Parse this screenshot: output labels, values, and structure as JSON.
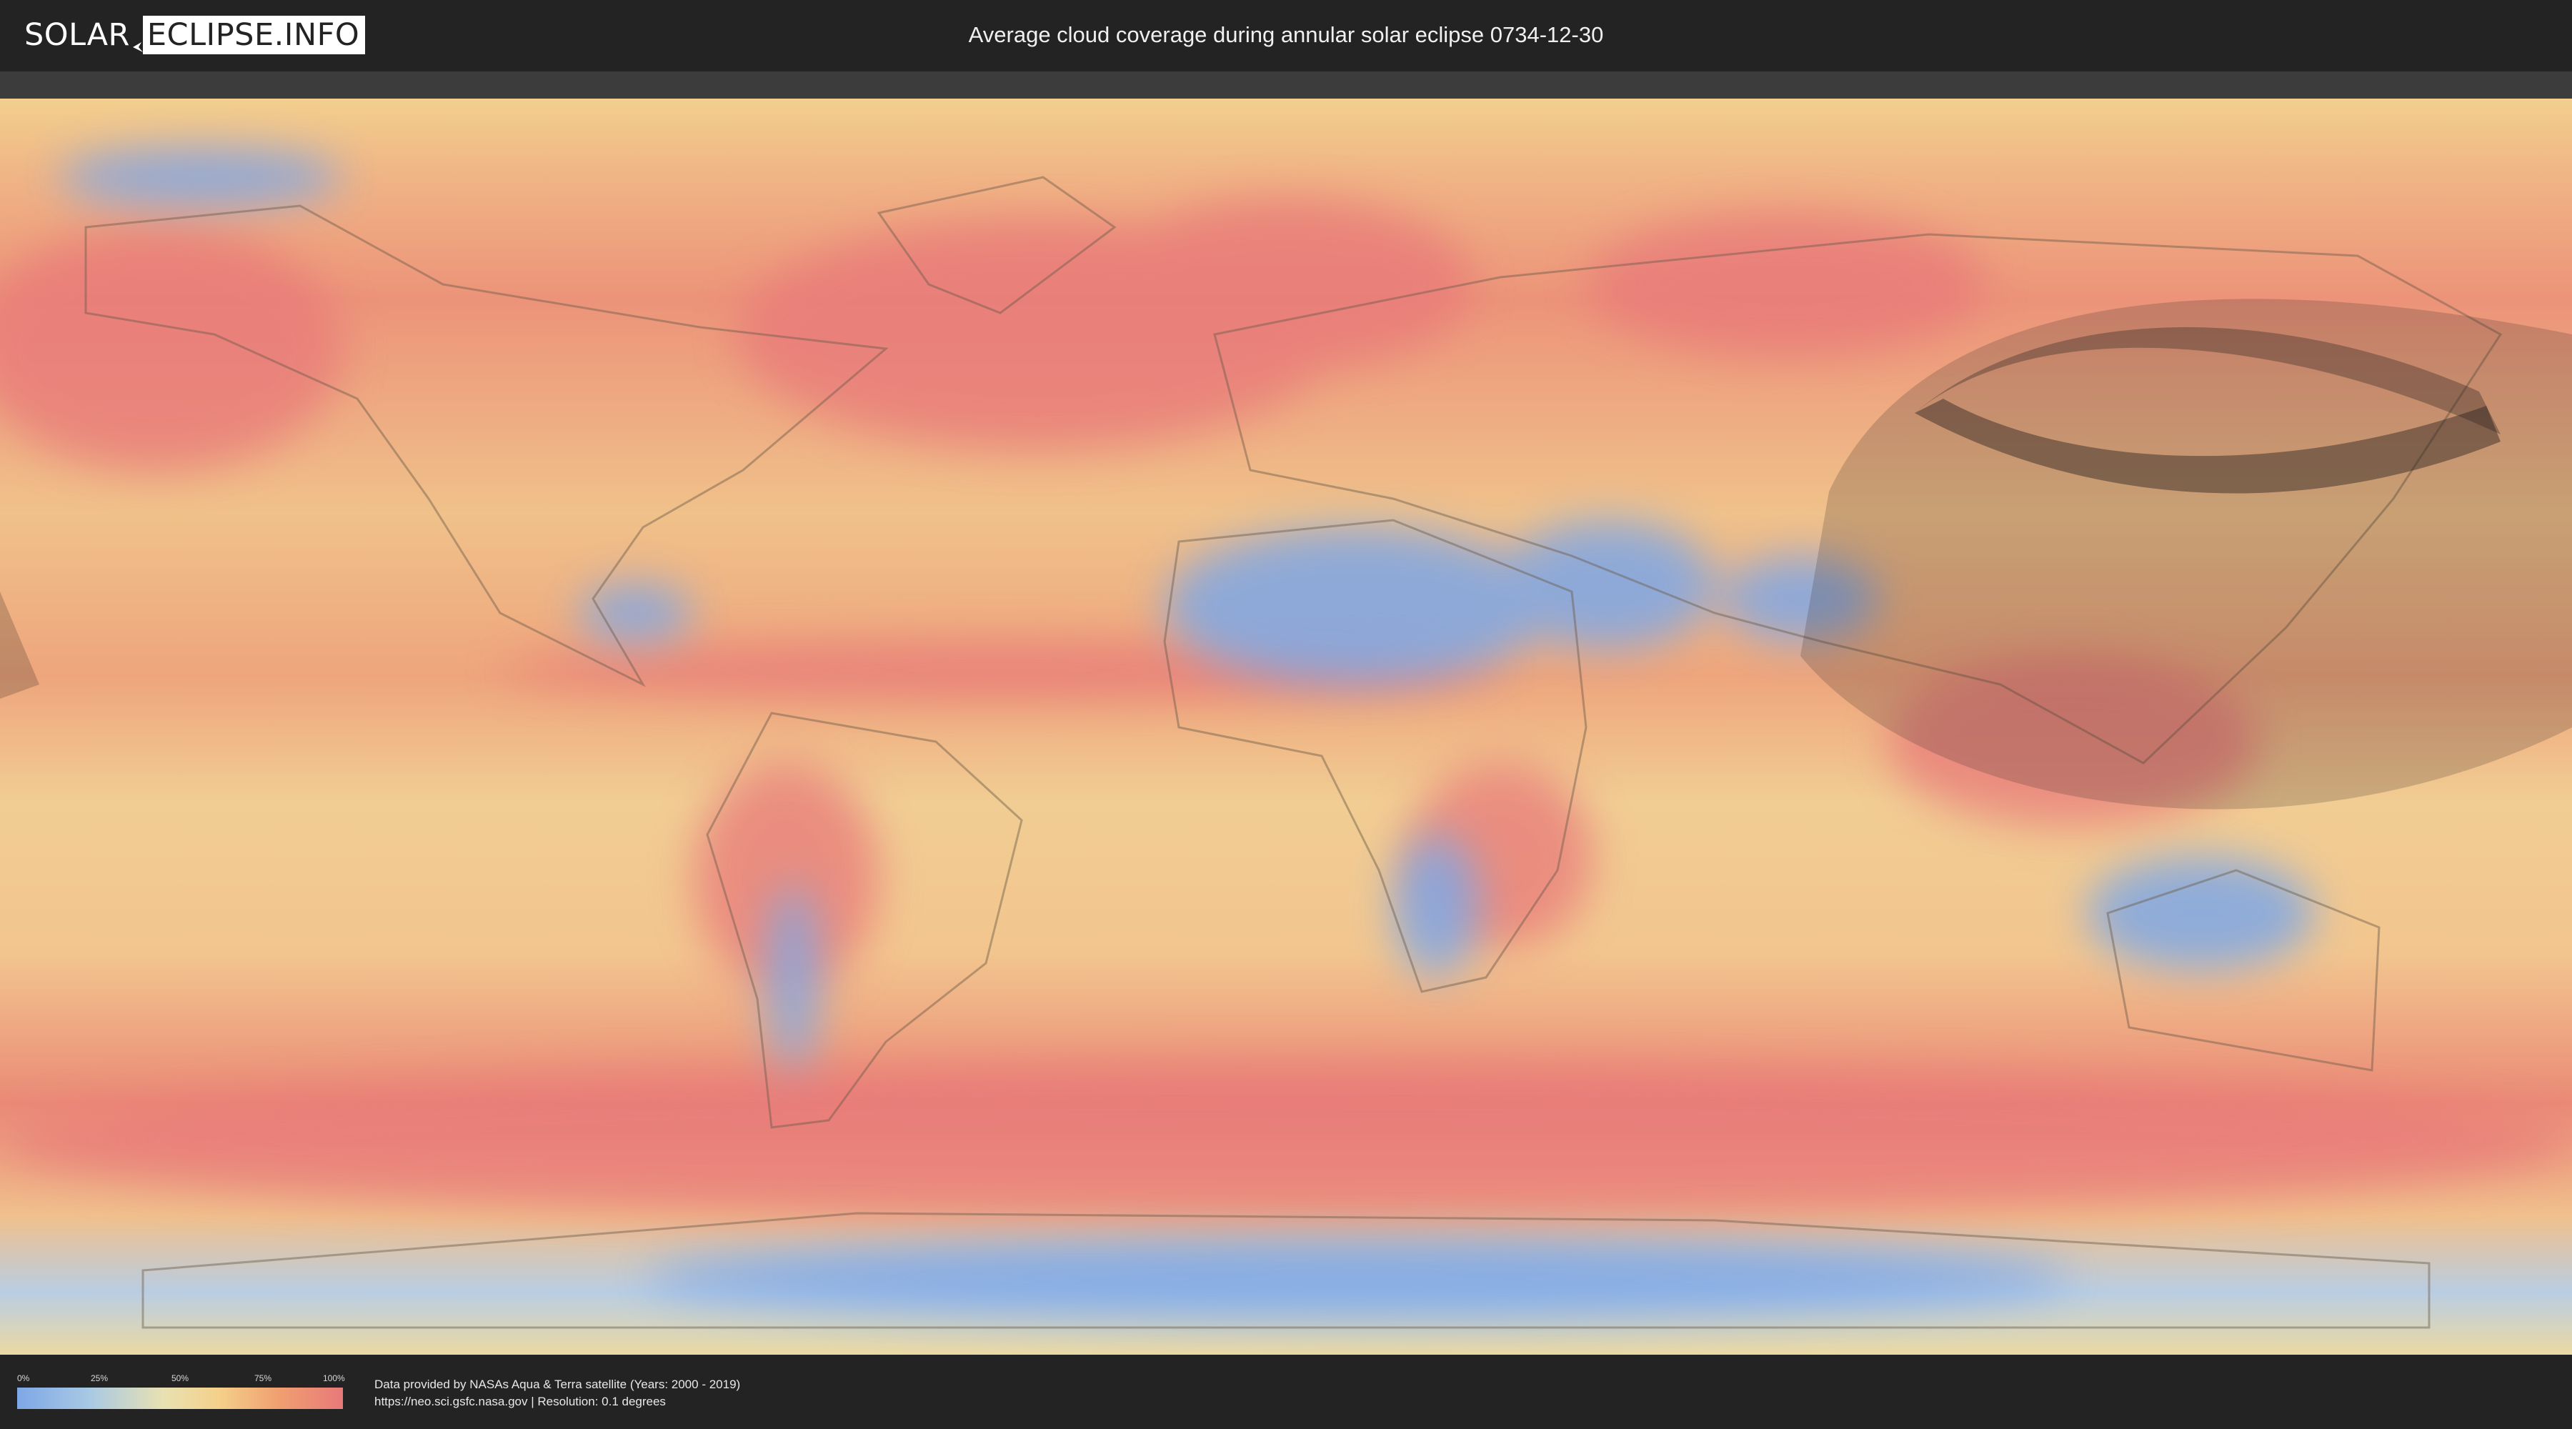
{
  "header": {
    "logo_left": "SOLAR",
    "logo_right": "ECLIPSE.INFO",
    "title": "Average cloud coverage during annular solar eclipse 0734-12-30"
  },
  "map": {
    "type": "world cloud coverage map",
    "overlay": "annular eclipse path shadow over eastern Asia"
  },
  "legend": {
    "ticks": [
      "0%",
      "25%",
      "50%",
      "75%",
      "100%"
    ],
    "colors": [
      "#7ea7e6",
      "#a8c9e4",
      "#e8e1b2",
      "#f4d08a",
      "#f0a070",
      "#e8797a"
    ]
  },
  "footer": {
    "line1": "Data provided by NASAs Aqua & Terra satellite (Years: 2000 - 2019)",
    "line2": "https://neo.sci.gsfc.nasa.gov | Resolution: 0.1 degrees"
  }
}
